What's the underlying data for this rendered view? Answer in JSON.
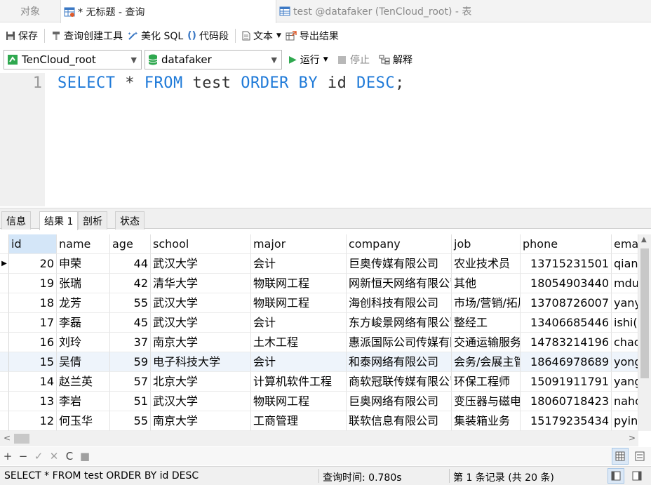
{
  "tabs": {
    "objects": "对象",
    "query": "* 无标题 - 查询",
    "table": "test @datafaker (TenCloud_root) - 表"
  },
  "toolbar": {
    "save": "保存",
    "query_builder": "查询创建工具",
    "beautify": "美化 SQL",
    "snippet": "代码段",
    "text": "文本",
    "export": "导出结果"
  },
  "runbar": {
    "connection": "TenCloud_root",
    "database": "datafaker",
    "run": "运行",
    "stop": "停止",
    "explain": "解释"
  },
  "editor": {
    "line_number": "1",
    "tokens": {
      "select": "SELECT",
      "star": " * ",
      "from": "FROM",
      "table": " test ",
      "order_by": "ORDER BY",
      "column": " id ",
      "desc": "DESC",
      "semicolon": ";"
    }
  },
  "result_tabs": {
    "info": "信息",
    "result": "结果 1",
    "profile": "剖析",
    "status": "状态"
  },
  "grid": {
    "columns": [
      "id",
      "name",
      "age",
      "school",
      "major",
      "company",
      "job",
      "phone",
      "ema"
    ],
    "rows": [
      [
        "20",
        "申荣",
        "44",
        "武汉大学",
        "会计",
        "巨奥传媒有限公司",
        "农业技术员",
        "13715231501",
        "qian"
      ],
      [
        "19",
        "张瑞",
        "42",
        "清华大学",
        "物联网工程",
        "网新恒天网络有限公司",
        "其他",
        "18054903440",
        "mdu"
      ],
      [
        "18",
        "龙芳",
        "55",
        "武汉大学",
        "物联网工程",
        "海创科技有限公司",
        "市场/营销/拓展",
        "13708726007",
        "yany"
      ],
      [
        "17",
        "李磊",
        "45",
        "武汉大学",
        "会计",
        "东方峻景网络有限公司",
        "整经工",
        "13406685446",
        "ishi("
      ],
      [
        "16",
        "刘玲",
        "37",
        "南京大学",
        "土木工程",
        "惠派国际公司传媒有限公司",
        "交通运输服务",
        "14783214196",
        "chac"
      ],
      [
        "15",
        "吴倩",
        "59",
        "电子科技大学",
        "会计",
        "和泰网络有限公司",
        "会务/会展主管",
        "18646978689",
        "yong"
      ],
      [
        "14",
        "赵兰英",
        "57",
        "北京大学",
        "计算机软件工程",
        "商软冠联传媒有限公司",
        "环保工程师",
        "15091911791",
        "yang"
      ],
      [
        "13",
        "李岩",
        "51",
        "武汉大学",
        "物联网工程",
        "巨奥网络有限公司",
        "变压器与磁电",
        "18060718423",
        "naho"
      ],
      [
        "12",
        "何玉华",
        "55",
        "南京大学",
        "工商管理",
        "联软信息有限公司",
        "集装箱业务",
        "15179235434",
        "pyin"
      ]
    ]
  },
  "gridbar": {
    "add": "+",
    "remove": "−",
    "apply": "✓",
    "discard": "✕",
    "refresh": "C",
    "stop": "■"
  },
  "status": {
    "sql": "SELECT * FROM test ORDER BY id DESC",
    "time": "查询时间: 0.780s",
    "record": "第 1 条记录  (共 20 条)"
  }
}
